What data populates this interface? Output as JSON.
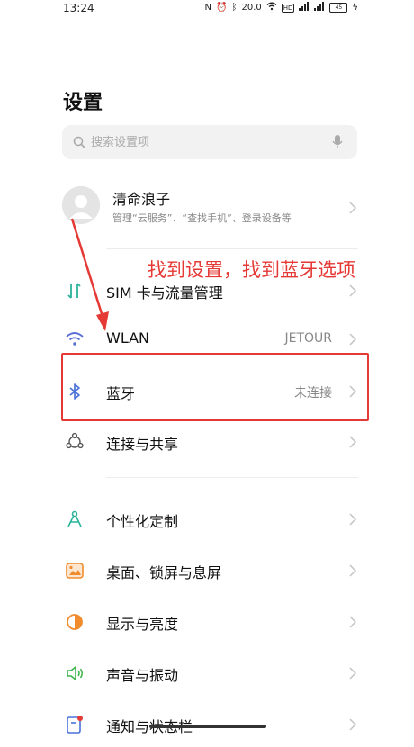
{
  "status": {
    "time": "13:24",
    "icons": [
      "nfc-icon",
      "alarm-icon",
      "bluetooth-icon",
      "speed-icon",
      "wifi-icon",
      "hd-icon",
      "signal-icon",
      "signal-icon",
      "battery-icon"
    ],
    "speed": "20.0",
    "battery": "45"
  },
  "page": {
    "title": "设置"
  },
  "search": {
    "placeholder": "搜索设置项"
  },
  "account": {
    "name": "清命浪子",
    "description": "管理“云服务”、“查找手机”、登录设备等"
  },
  "rows": [
    {
      "label": "SIM 卡与流量管理",
      "value": "",
      "icon": "sim-data-icon",
      "icon_color": "#2bb39b"
    },
    {
      "label": "WLAN",
      "value": "JETOUR",
      "icon": "wifi-icon",
      "icon_color": "#5a6fd6"
    },
    {
      "label": "蓝牙",
      "value": "未连接",
      "icon": "bluetooth-icon",
      "icon_color": "#4a72d9"
    },
    {
      "label": "连接与共享",
      "value": "",
      "icon": "share-icon",
      "icon_color": "#555555"
    },
    {
      "label": "个性化定制",
      "value": "",
      "icon": "personalize-icon",
      "icon_color": "#2bb39b"
    },
    {
      "label": "桌面、锁屏与息屏",
      "value": "",
      "icon": "wallpaper-icon",
      "icon_color": "#f08c2e"
    },
    {
      "label": "显示与亮度",
      "value": "",
      "icon": "brightness-icon",
      "icon_color": "#f08c2e"
    },
    {
      "label": "声音与振动",
      "value": "",
      "icon": "sound-icon",
      "icon_color": "#3bb54a"
    },
    {
      "label": "通知与状态栏",
      "value": "",
      "icon": "notification-icon",
      "icon_color": "#4a72d9"
    }
  ],
  "annotation": {
    "text": "找到设置，找到蓝牙选项",
    "color": "#e53935"
  }
}
